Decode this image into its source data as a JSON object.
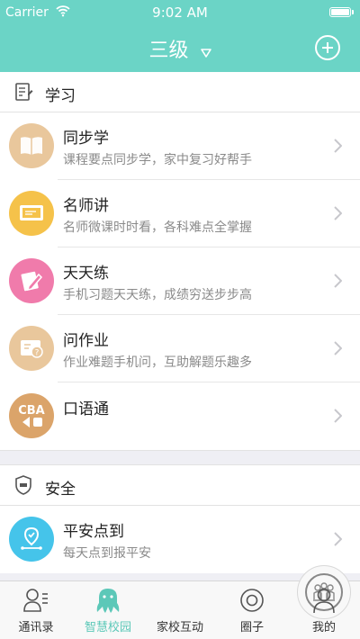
{
  "status_bar": {
    "carrier": "Carrier",
    "time": "9:02 AM"
  },
  "nav": {
    "title": "三级"
  },
  "sections": [
    {
      "title": "学习",
      "icon": "notebook-icon",
      "items": [
        {
          "title": "同步学",
          "subtitle": "课程要点同步学，家中复习好帮手",
          "icon": "book-icon",
          "color": "#e9c79c"
        },
        {
          "title": "名师讲",
          "subtitle": "名师微课时时看，各科难点全掌握",
          "icon": "blackboard-icon",
          "color": "#f5c24a"
        },
        {
          "title": "天天练",
          "subtitle": "手机习题天天练，成绩穷送步步高",
          "icon": "pencil-paper-icon",
          "color": "#f07bab"
        },
        {
          "title": "问作业",
          "subtitle": "作业难题手机问，互助解题乐趣多",
          "icon": "question-card-icon",
          "color": "#e9c79c"
        },
        {
          "title": "口语通",
          "subtitle": "",
          "icon": "cba-letters-icon",
          "color": "#dba46a",
          "icon_text": "CBA"
        }
      ]
    },
    {
      "title": "安全",
      "icon": "shield-icon",
      "items": [
        {
          "title": "平安点到",
          "subtitle": "每天点到报平安",
          "icon": "location-pin-icon",
          "color": "#45c4ea"
        }
      ]
    }
  ],
  "tabs": [
    {
      "label": "通讯录",
      "icon": "contacts-icon"
    },
    {
      "label": "智慧校园",
      "icon": "octopus-icon",
      "active": true
    },
    {
      "label": "家校互动",
      "icon": "group-icon"
    },
    {
      "label": "圈子",
      "icon": "circle-icon"
    },
    {
      "label": "我的",
      "icon": "person-icon"
    }
  ],
  "colors": {
    "primary": "#6bd4c6",
    "active_tab": "#5cc8b8",
    "background": "#efeff4"
  }
}
